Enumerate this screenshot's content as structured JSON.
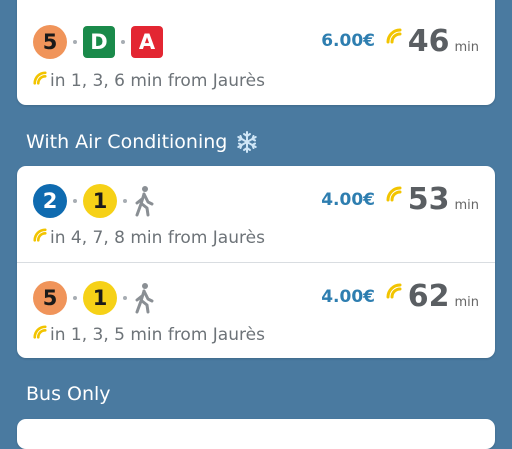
{
  "sections": [
    {
      "header": "",
      "routes": [
        {
          "lines": [
            {
              "label": "5",
              "shape": "circle",
              "color": "#f0945a"
            },
            {
              "label": "D",
              "shape": "square",
              "color": "#1a8a4a"
            },
            {
              "label": "A",
              "shape": "square",
              "color": "#e32632"
            }
          ],
          "price": "6.00€",
          "duration": "46",
          "unit": "min",
          "next": "in 1, 3, 6 min from Jaurès"
        }
      ]
    },
    {
      "header": "With Air Conditioning",
      "header_icon": "snowflake-icon",
      "routes": [
        {
          "lines": [
            {
              "label": "2",
              "shape": "circle",
              "color": "#0f6bb0"
            },
            {
              "label": "1",
              "shape": "circle",
              "color": "#f6d117"
            },
            {
              "label": "",
              "shape": "walk",
              "color": "#8a8f94"
            }
          ],
          "price": "4.00€",
          "duration": "53",
          "unit": "min",
          "next": "in 4, 7, 8 min from Jaurès"
        },
        {
          "lines": [
            {
              "label": "5",
              "shape": "circle",
              "color": "#f0945a"
            },
            {
              "label": "1",
              "shape": "circle",
              "color": "#f6d117"
            },
            {
              "label": "",
              "shape": "walk",
              "color": "#8a8f94"
            }
          ],
          "price": "4.00€",
          "duration": "62",
          "unit": "min",
          "next": "in 1, 3, 5 min from Jaurès"
        }
      ]
    },
    {
      "header": "Bus Only",
      "routes": []
    }
  ],
  "colors": {
    "background": "#4a7aa0",
    "price": "#2e7eb0",
    "realtime": "#f2c400"
  }
}
